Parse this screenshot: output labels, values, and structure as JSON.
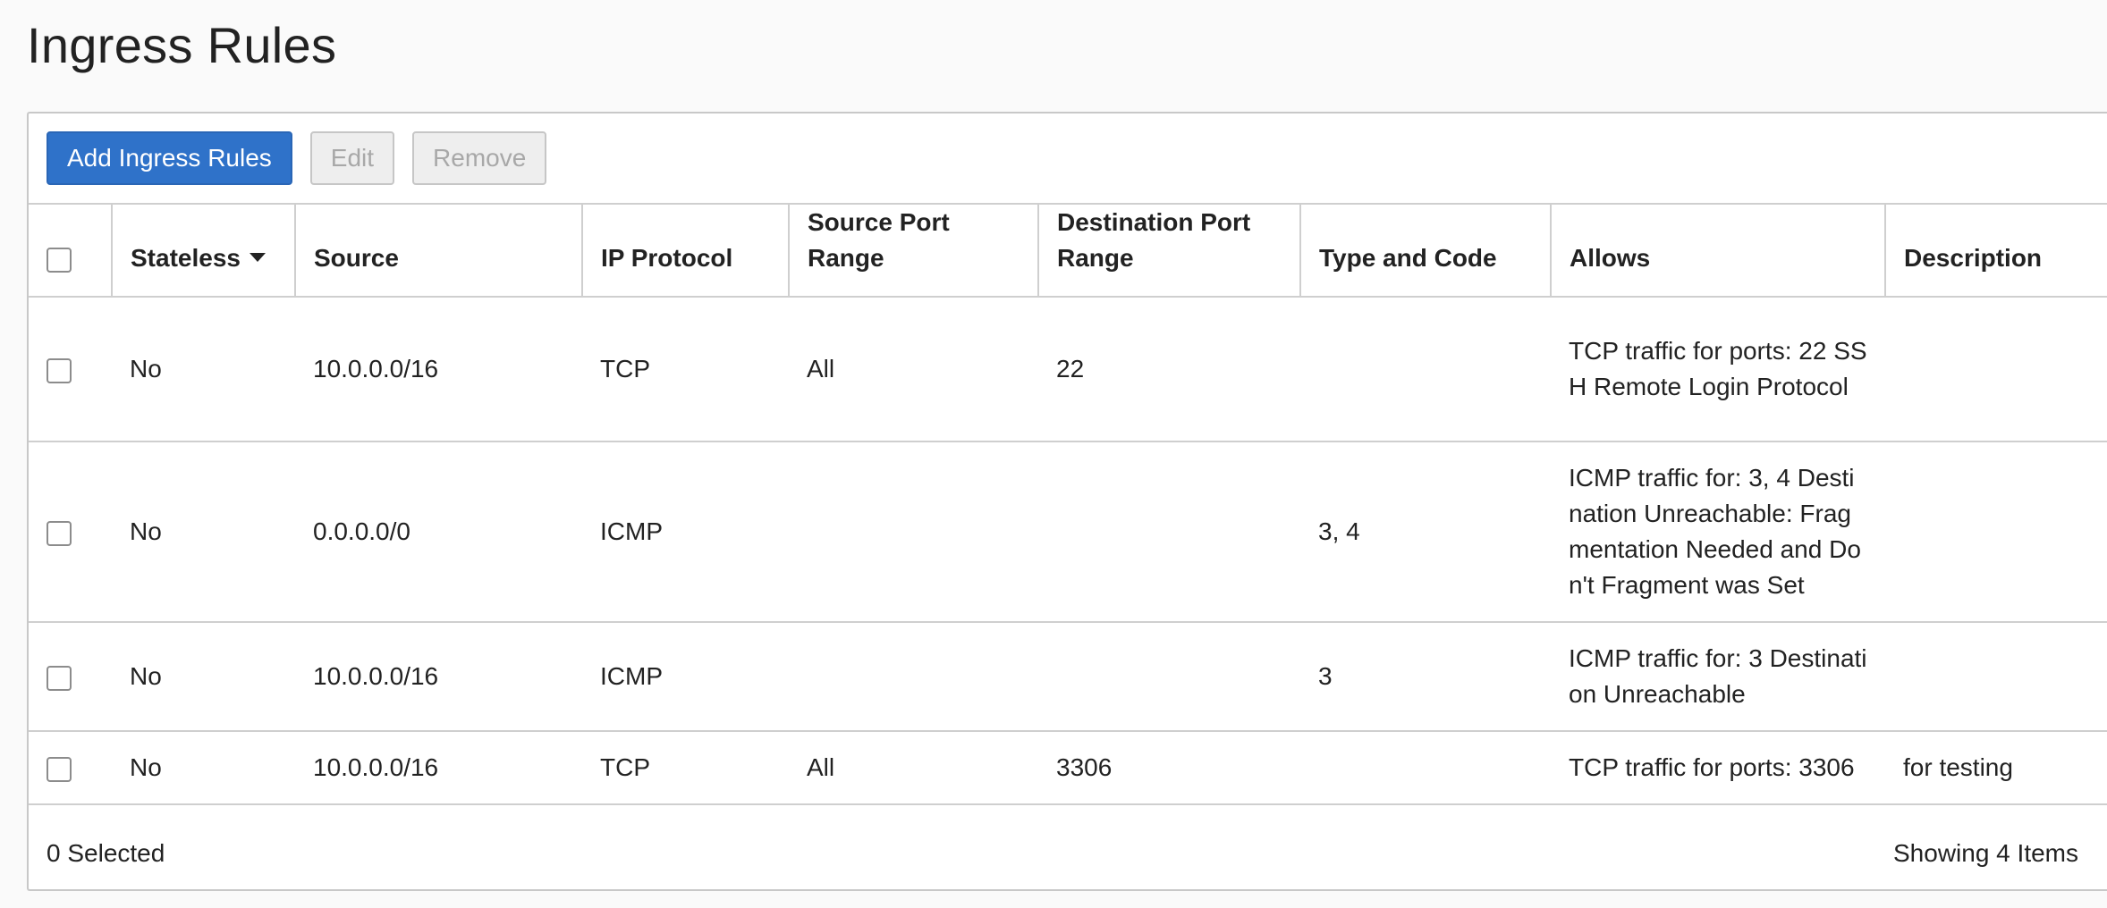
{
  "page": {
    "title": "Ingress Rules"
  },
  "toolbar": {
    "add_label": "Add Ingress Rules",
    "edit_label": "Edit",
    "remove_label": "Remove"
  },
  "table": {
    "headers": {
      "stateless": "Stateless",
      "source": "Source",
      "ip_protocol": "IP Protocol",
      "source_port_range": "Source Port Range",
      "destination_port_range": "Destination Port Range",
      "type_and_code": "Type and Code",
      "allows": "Allows",
      "description": "Description"
    },
    "rows": [
      {
        "stateless": "No",
        "source": "10.0.0.0/16",
        "ip_protocol": "TCP",
        "source_port_range": "All",
        "destination_port_range": "22",
        "type_and_code": "",
        "allows": "TCP traffic for ports: 22 SSH Remote Login Protocol",
        "description": ""
      },
      {
        "stateless": "No",
        "source": "0.0.0.0/0",
        "ip_protocol": "ICMP",
        "source_port_range": "",
        "destination_port_range": "",
        "type_and_code": "3, 4",
        "allows": "ICMP traffic for: 3, 4 Destination Unreachable: Fragmentation Needed and Don't Fragment was Set",
        "description": ""
      },
      {
        "stateless": "No",
        "source": "10.0.0.0/16",
        "ip_protocol": "ICMP",
        "source_port_range": "",
        "destination_port_range": "",
        "type_and_code": "3",
        "allows": "ICMP traffic for: 3 Destination Unreachable",
        "description": ""
      },
      {
        "stateless": "No",
        "source": "10.0.0.0/16",
        "ip_protocol": "TCP",
        "source_port_range": "All",
        "destination_port_range": "3306",
        "type_and_code": "",
        "allows": "TCP traffic for ports: 3306",
        "description": "for testing"
      }
    ]
  },
  "footer": {
    "selected_text": "0 Selected",
    "showing_text": "Showing 4 Items"
  },
  "colors": {
    "primary": "#2f72c9",
    "border": "#cfcfcf",
    "disabled_text": "#a8a8a8"
  },
  "icons": {
    "sort": "caret-down-icon"
  }
}
